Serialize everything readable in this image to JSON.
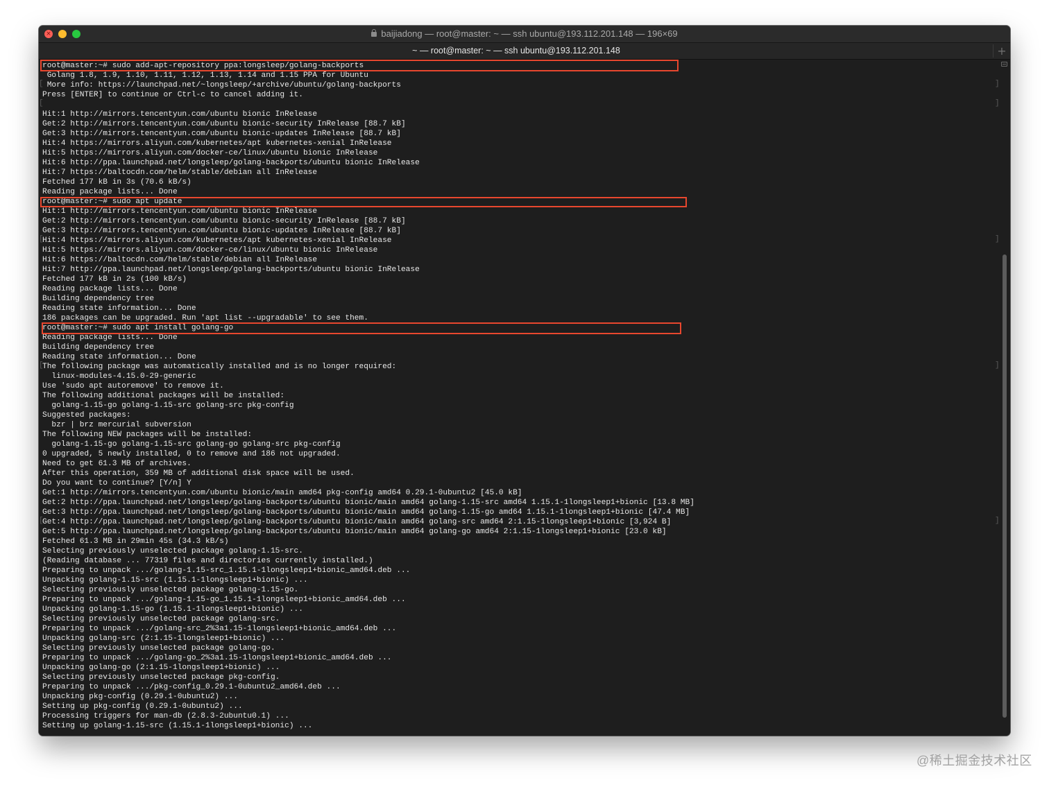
{
  "window": {
    "title": "baijiadong — root@master: ~ — ssh ubuntu@193.112.201.148 — 196×69",
    "tab_label": "~ — root@master: ~ — ssh ubuntu@193.112.201.148",
    "new_tab_glyph": "+",
    "close_glyph": "×"
  },
  "colors": {
    "terminal_bg": "#1e1e1e",
    "terminal_text": "#e8e8e8",
    "highlight_box": "#e8472e",
    "close": "#ff5f57",
    "minimize": "#febc2e",
    "zoom": "#28c840"
  },
  "icons": {
    "title_icon": "lock-icon",
    "traffic_lights": [
      "close-icon",
      "minimize-icon",
      "zoom-icon"
    ],
    "new_tab": "plus-icon"
  },
  "terminal": {
    "lines": [
      "root@master:~# sudo add-apt-repository ppa:longsleep/golang-backports",
      " Golang 1.8, 1.9, 1.10, 1.11, 1.12, 1.13, 1.14 and 1.15 PPA for Ubuntu",
      " More info: https://launchpad.net/~longsleep/+archive/ubuntu/golang-backports",
      "Press [ENTER] to continue or Ctrl-c to cancel adding it.",
      "",
      "Hit:1 http://mirrors.tencentyun.com/ubuntu bionic InRelease",
      "Get:2 http://mirrors.tencentyun.com/ubuntu bionic-security InRelease [88.7 kB]",
      "Get:3 http://mirrors.tencentyun.com/ubuntu bionic-updates InRelease [88.7 kB]",
      "Hit:4 https://mirrors.aliyun.com/kubernetes/apt kubernetes-xenial InRelease",
      "Hit:5 https://mirrors.aliyun.com/docker-ce/linux/ubuntu bionic InRelease",
      "Hit:6 http://ppa.launchpad.net/longsleep/golang-backports/ubuntu bionic InRelease",
      "Hit:7 https://baltocdn.com/helm/stable/debian all InRelease",
      "Fetched 177 kB in 3s (70.6 kB/s)",
      "Reading package lists... Done",
      "root@master:~# sudo apt update",
      "Hit:1 http://mirrors.tencentyun.com/ubuntu bionic InRelease",
      "Get:2 http://mirrors.tencentyun.com/ubuntu bionic-security InRelease [88.7 kB]",
      "Get:3 http://mirrors.tencentyun.com/ubuntu bionic-updates InRelease [88.7 kB]",
      "Hit:4 https://mirrors.aliyun.com/kubernetes/apt kubernetes-xenial InRelease",
      "Hit:5 https://mirrors.aliyun.com/docker-ce/linux/ubuntu bionic InRelease",
      "Hit:6 https://baltocdn.com/helm/stable/debian all InRelease",
      "Hit:7 http://ppa.launchpad.net/longsleep/golang-backports/ubuntu bionic InRelease",
      "Fetched 177 kB in 2s (100 kB/s)",
      "Reading package lists... Done",
      "Building dependency tree",
      "Reading state information... Done",
      "186 packages can be upgraded. Run 'apt list --upgradable' to see them.",
      "root@master:~# sudo apt install golang-go",
      "Reading package lists... Done",
      "Building dependency tree",
      "Reading state information... Done",
      "The following package was automatically installed and is no longer required:",
      "  linux-modules-4.15.0-29-generic",
      "Use 'sudo apt autoremove' to remove it.",
      "The following additional packages will be installed:",
      "  golang-1.15-go golang-1.15-src golang-src pkg-config",
      "Suggested packages:",
      "  bzr | brz mercurial subversion",
      "The following NEW packages will be installed:",
      "  golang-1.15-go golang-1.15-src golang-go golang-src pkg-config",
      "0 upgraded, 5 newly installed, 0 to remove and 186 not upgraded.",
      "Need to get 61.3 MB of archives.",
      "After this operation, 359 MB of additional disk space will be used.",
      "Do you want to continue? [Y/n] Y",
      "Get:1 http://mirrors.tencentyun.com/ubuntu bionic/main amd64 pkg-config amd64 0.29.1-0ubuntu2 [45.0 kB]",
      "Get:2 http://ppa.launchpad.net/longsleep/golang-backports/ubuntu bionic/main amd64 golang-1.15-src amd64 1.15.1-1longsleep1+bionic [13.8 MB]",
      "Get:3 http://ppa.launchpad.net/longsleep/golang-backports/ubuntu bionic/main amd64 golang-1.15-go amd64 1.15.1-1longsleep1+bionic [47.4 MB]",
      "Get:4 http://ppa.launchpad.net/longsleep/golang-backports/ubuntu bionic/main amd64 golang-src amd64 2:1.15-1longsleep1+bionic [3,924 B]",
      "Get:5 http://ppa.launchpad.net/longsleep/golang-backports/ubuntu bionic/main amd64 golang-go amd64 2:1.15-1longsleep1+bionic [23.0 kB]",
      "Fetched 61.3 MB in 29min 45s (34.3 kB/s)",
      "Selecting previously unselected package golang-1.15-src.",
      "(Reading database ... 77319 files and directories currently installed.)",
      "Preparing to unpack .../golang-1.15-src_1.15.1-1longsleep1+bionic_amd64.deb ...",
      "Unpacking golang-1.15-src (1.15.1-1longsleep1+bionic) ...",
      "Selecting previously unselected package golang-1.15-go.",
      "Preparing to unpack .../golang-1.15-go_1.15.1-1longsleep1+bionic_amd64.deb ...",
      "Unpacking golang-1.15-go (1.15.1-1longsleep1+bionic) ...",
      "Selecting previously unselected package golang-src.",
      "Preparing to unpack .../golang-src_2%3a1.15-1longsleep1+bionic_amd64.deb ...",
      "Unpacking golang-src (2:1.15-1longsleep1+bionic) ...",
      "Selecting previously unselected package golang-go.",
      "Preparing to unpack .../golang-go_2%3a1.15-1longsleep1+bionic_amd64.deb ...",
      "Unpacking golang-go (2:1.15-1longsleep1+bionic) ...",
      "Selecting previously unselected package pkg-config.",
      "Preparing to unpack .../pkg-config_0.29.1-0ubuntu2_amd64.deb ...",
      "Unpacking pkg-config (0.29.1-0ubuntu2) ...",
      "Setting up pkg-config (0.29.1-0ubuntu2) ...",
      "Processing triggers for man-db (2.8.3-2ubuntu0.1) ...",
      "Setting up golang-1.15-src (1.15.1-1longsleep1+bionic) ..."
    ]
  },
  "watermark": "@稀土掘金技术社区"
}
